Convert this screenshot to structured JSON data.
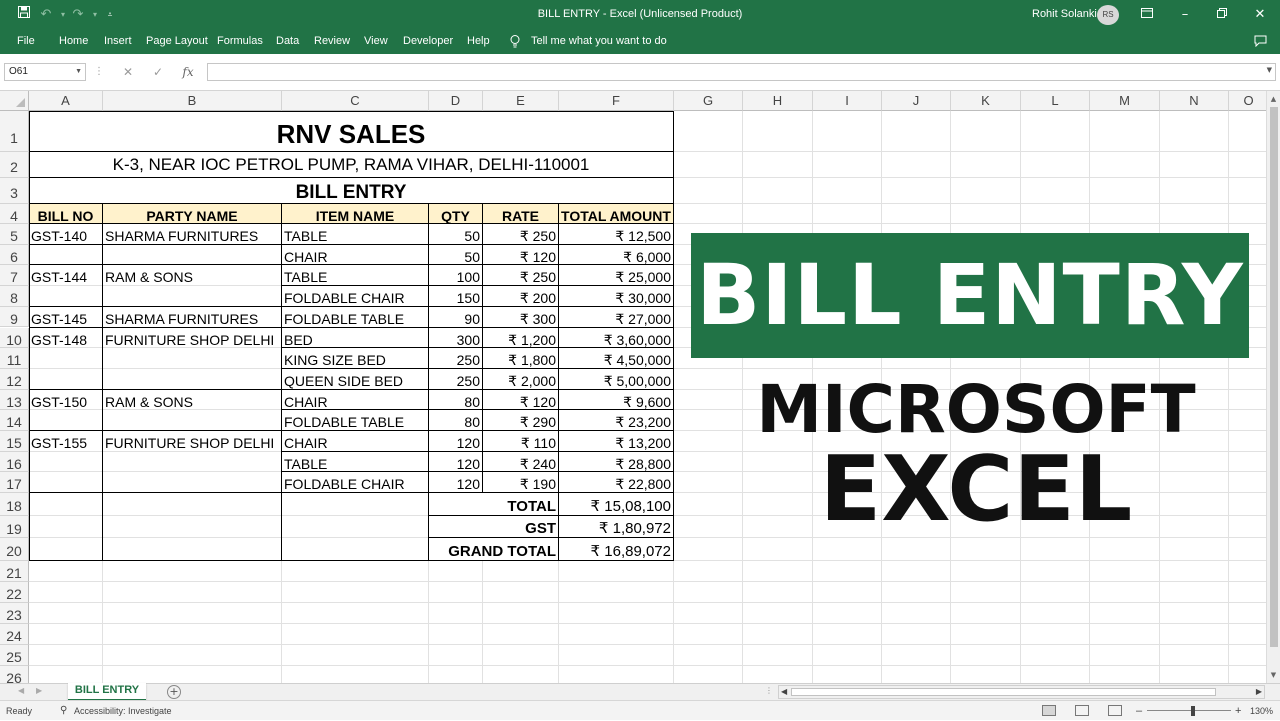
{
  "window": {
    "title": "BILL ENTRY  -  Excel (Unlicensed Product)",
    "user_name": "Rohit Solanki",
    "user_initials": "RS"
  },
  "menu": {
    "items": [
      "File",
      "Home",
      "Insert",
      "Page Layout",
      "Formulas",
      "Data",
      "Review",
      "View",
      "Developer",
      "Help"
    ],
    "tell_me": "Tell me what you want to do"
  },
  "formula_bar": {
    "name_box": "O61",
    "fx_label": "fx",
    "formula": ""
  },
  "columns": [
    "A",
    "B",
    "C",
    "D",
    "E",
    "F",
    "G",
    "H",
    "I",
    "J",
    "K",
    "L",
    "M",
    "N",
    "O"
  ],
  "rows": [
    "1",
    "2",
    "3",
    "4",
    "5",
    "6",
    "7",
    "8",
    "9",
    "10",
    "11",
    "12",
    "13",
    "14",
    "15",
    "16",
    "17",
    "18",
    "19",
    "20",
    "21",
    "22",
    "23",
    "24",
    "25",
    "26"
  ],
  "sheet": {
    "company": "RNV SALES",
    "address": "K-3, NEAR IOC PETROL PUMP, RAMA VIHAR, DELHI-110001",
    "heading": "BILL ENTRY",
    "headers": [
      "BILL NO",
      "PARTY NAME",
      "ITEM NAME",
      "QTY",
      "RATE",
      "TOTAL AMOUNT"
    ],
    "data_rows": [
      [
        "GST-140",
        "SHARMA FURNITURES",
        "TABLE",
        "50",
        "₹ 250",
        "₹ 12,500"
      ],
      [
        "",
        "",
        "CHAIR",
        "50",
        "₹ 120",
        "₹ 6,000"
      ],
      [
        "GST-144",
        "RAM & SONS",
        "TABLE",
        "100",
        "₹ 250",
        "₹ 25,000"
      ],
      [
        "",
        "",
        "FOLDABLE CHAIR",
        "150",
        "₹ 200",
        "₹ 30,000"
      ],
      [
        "GST-145",
        "SHARMA FURNITURES",
        "FOLDABLE TABLE",
        "90",
        "₹ 300",
        "₹ 27,000"
      ],
      [
        "GST-148",
        "FURNITURE SHOP DELHI",
        "BED",
        "300",
        "₹ 1,200",
        "₹ 3,60,000"
      ],
      [
        "",
        "",
        "KING SIZE BED",
        "250",
        "₹ 1,800",
        "₹ 4,50,000"
      ],
      [
        "",
        "",
        "QUEEN SIDE BED",
        "250",
        "₹ 2,000",
        "₹ 5,00,000"
      ],
      [
        "GST-150",
        "RAM & SONS",
        "CHAIR",
        "80",
        "₹ 120",
        "₹ 9,600"
      ],
      [
        "",
        "",
        "FOLDABLE TABLE",
        "80",
        "₹ 290",
        "₹ 23,200"
      ],
      [
        "GST-155",
        "FURNITURE SHOP DELHI",
        "CHAIR",
        "120",
        "₹ 110",
        "₹ 13,200"
      ],
      [
        "",
        "",
        "TABLE",
        "120",
        "₹ 240",
        "₹ 28,800"
      ],
      [
        "",
        "",
        "FOLDABLE CHAIR",
        "120",
        "₹ 190",
        "₹ 22,800"
      ]
    ],
    "summary": [
      {
        "label": "TOTAL",
        "value": "₹ 15,08,100"
      },
      {
        "label": "GST",
        "value": "₹ 1,80,972"
      },
      {
        "label": "GRAND TOTAL",
        "value": "₹ 16,89,072"
      }
    ]
  },
  "overlay": {
    "banner": "BILL ENTRY",
    "line1": "MICROSOFT",
    "line2": "EXCEL"
  },
  "sheet_tabs": [
    "BILL ENTRY"
  ],
  "status": {
    "ready": "Ready",
    "accessibility": "Accessibility: Investigate",
    "zoom": "130%"
  },
  "colors": {
    "excel_green": "#217346",
    "header_fill": "#fff2cc"
  }
}
